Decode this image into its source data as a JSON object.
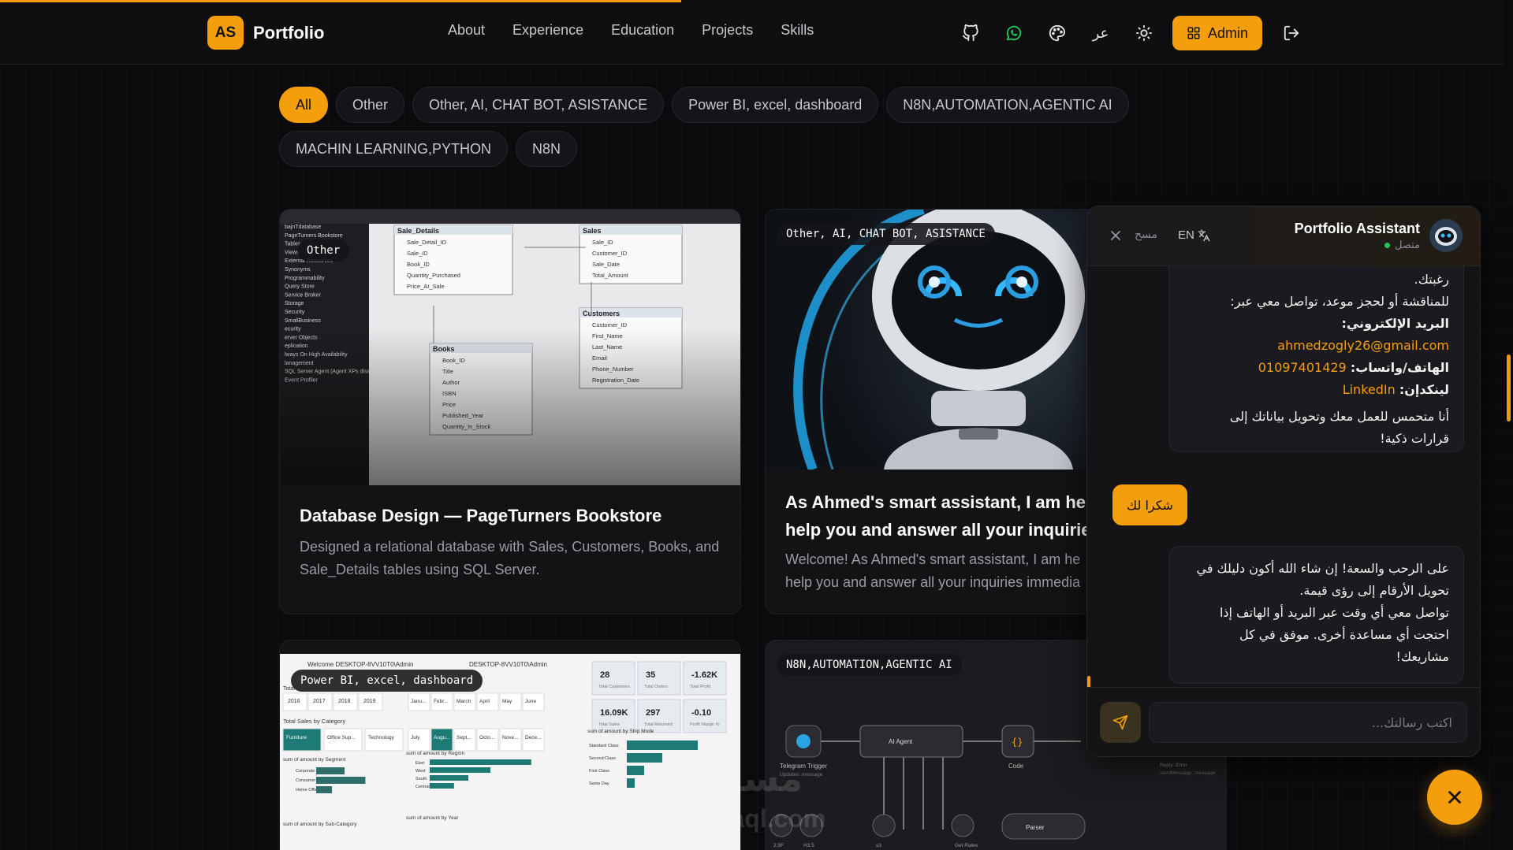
{
  "progress": {
    "fraction": 0.45
  },
  "nav": {
    "logo_initials": "AS",
    "logo_text": "Portfolio",
    "links": [
      "About",
      "Experience",
      "Education",
      "Projects",
      "Skills"
    ],
    "language_toggle": "عر",
    "admin_label": "Admin",
    "icons": [
      "github-icon",
      "whatsapp-icon",
      "palette-icon",
      "language-icon",
      "sun-icon",
      "logout-icon"
    ]
  },
  "filters": {
    "row1": [
      "All",
      "Other",
      "Other, AI, CHAT BOT, ASISTANCE",
      "Power BI, excel, dashboard",
      "N8N,AUTOMATION,AGENTIC AI"
    ],
    "row2": [
      "MACHIN LEARNING,PYTHON",
      "N8N"
    ],
    "active": "All"
  },
  "projects": [
    {
      "tag": "Other",
      "title": "Database Design — PageTurners Bookstore",
      "description": "Designed a relational database with Sales, Customers, Books, and Sale_Details tables using SQL Server.",
      "diagram": {
        "sidebar_items": [
          "bajnTdatabase",
          "PageTurners Bookstore",
          "Tables",
          "Views",
          "External Resources",
          "Synonyms",
          "Programmability",
          "Query Store",
          "Service Broker",
          "Storage",
          "Security",
          "SmallBusiness",
          "ecurity",
          "erver Objects",
          "eplication",
          "lways On High Availability",
          "lanagement",
          "SQL Server Agent (Agent XPs disabl",
          "Event Profiler"
        ],
        "tables": [
          {
            "name": "Sale_Details",
            "fields": [
              "Sale_Detail_ID",
              "Sale_ID",
              "Book_ID",
              "Quantity_Purchased",
              "Price_At_Sale"
            ]
          },
          {
            "name": "Sales",
            "fields": [
              "Sale_ID",
              "Customer_ID",
              "Sale_Date",
              "Total_Amount"
            ]
          },
          {
            "name": "Books",
            "fields": [
              "Book_ID",
              "Title",
              "Author",
              "ISBN",
              "Price",
              "Published_Year",
              "Quantity_In_Stock"
            ]
          },
          {
            "name": "Customers",
            "fields": [
              "Customer_ID",
              "First_Name",
              "Last_Name",
              "Email",
              "Phone_Number",
              "Registration_Date"
            ]
          }
        ]
      }
    },
    {
      "tag": "Other, AI, CHAT BOT, ASISTANCE",
      "title_line1": "As Ahmed's smart assistant, I am here a",
      "title_line2": "help you and answer all your inquiries ir",
      "desc_line1": "Welcome! As Ahmed's smart assistant, I am he",
      "desc_line2": "help you and answer all your inquiries immedia"
    },
    {
      "tag": "Power BI, excel, dashboard",
      "dashboard": {
        "header_left": "Welcome DESKTOP-8VV10T0\\Admin",
        "header_right": "DESKTOP-8VV10T0\\Admin",
        "total_label": "Total",
        "years": [
          "2016",
          "2017",
          "2018",
          "2019"
        ],
        "months_top": [
          "Janu...",
          "Febr...",
          "March",
          "April",
          "May",
          "June"
        ],
        "months_bottom": [
          "July",
          "Augu...",
          "Sept...",
          "Octo...",
          "Nove...",
          "Dece..."
        ],
        "kpis": [
          {
            "value": "28",
            "label": "Total Customers"
          },
          {
            "value": "35",
            "label": "Total Orders"
          },
          {
            "value": "-1.62K",
            "label": "Total Profit"
          },
          {
            "value": "16.09K",
            "label": "Total Sales"
          },
          {
            "value": "297",
            "label": "Total Returned"
          },
          {
            "value": "-0.10",
            "label": "Profit Margin %"
          }
        ],
        "category_title": "Total Sales by Category",
        "categories": [
          "Furniture",
          "Office Sup...",
          "Technology"
        ],
        "segment_title": "sum of amount by Segment",
        "segments": [
          "Corporate",
          "Consumer",
          "Home Office"
        ],
        "segment_values": [
          0.45,
          0.78,
          0.25
        ],
        "region_title": "sum of amount by Region",
        "regions": [
          "East",
          "West",
          "South",
          "Central"
        ],
        "region_values": [
          0.92,
          0.55,
          0.35,
          0.22
        ],
        "shipmode_title": "sum of amount by Ship Mode",
        "shipmodes": [
          "Standard Class",
          "Second Class",
          "First Class",
          "Same Day"
        ],
        "shipmode_values": [
          0.9,
          0.45,
          0.22,
          0.1
        ],
        "subcat_title": "sum of amount by Sub-Category",
        "year_title": "sum of amount by Year"
      }
    },
    {
      "tag": "N8N,AUTOMATION,AGENTIC AI",
      "workflow": {
        "nodes": [
          "Telegram Trigger",
          "AI Agent",
          "Code",
          "Parser"
        ],
        "sub_labels": [
          "Updates: message",
          "Reply: Error",
          "sendMessage: message"
        ],
        "tools": [
          "2.5F",
          "H3.5",
          "s3",
          "Get Rates"
        ]
      }
    }
  ],
  "chat": {
    "title": "Portfolio Assistant",
    "status": "متصل",
    "lang_label": "EN",
    "clear_label": "مسح",
    "messages": {
      "bot1": {
        "line0": "رغبتك.",
        "line1": "للمناقشة أو لحجز موعد، تواصل معي عبر:",
        "email_label": "البريد الإلكتروني:",
        "email_value": "ahmedzogly26@gmail.com",
        "phone_label": "الهاتف/واتساب:",
        "phone_value": "01097401429",
        "linkedin_label": "لينكدإن:",
        "linkedin_value": "LinkedIn",
        "line_end1": "أنا متحمس للعمل معك وتحويل بياناتك إلى",
        "line_end2": "قرارات ذكية!"
      },
      "user1": "شكرا لك",
      "bot2": {
        "line1": "على الرحب والسعة! إن شاء الله أكون دليلك في",
        "line2": "تحويل الأرقام إلى رؤى قيمة.",
        "line3": "تواصل معي أي وقت عبر البريد أو الهاتف إذا",
        "line4": "احتجت أي مساعدة أخرى. موفق في كل",
        "line5": "مشاريعك!"
      }
    },
    "input_placeholder": "اكتب رسالتك..."
  },
  "watermark": "مستقل mostaql.com",
  "colors": {
    "accent": "#f59e0b",
    "background": "#0b0b0d",
    "card": "#131316"
  }
}
